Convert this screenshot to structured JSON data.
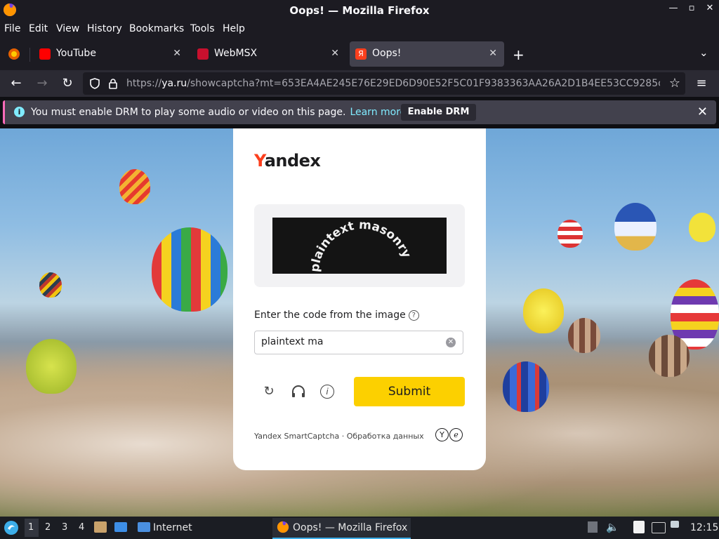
{
  "window": {
    "title": "Oops! — Mozilla Firefox"
  },
  "menu": [
    "File",
    "Edit",
    "View",
    "History",
    "Bookmarks",
    "Tools",
    "Help"
  ],
  "tabs": [
    {
      "label": "YouTube",
      "favicon_color": "#ff0000"
    },
    {
      "label": "WebMSX",
      "favicon_color": "#c8102e"
    },
    {
      "label": "Oops!",
      "favicon_color": "#fc3f1d",
      "active": true
    }
  ],
  "url": {
    "prefix": "https://",
    "host": "ya.ru",
    "rest": "/showcaptcha?mt=653EA4AE245E76E29ED6D90E52F5C01F9383363AA26A2D1B4EE53CC9285c"
  },
  "drm": {
    "message": "You must enable DRM to play some audio or video on this page.",
    "learn_more": "Learn more",
    "enable_button": "Enable DRM"
  },
  "captcha": {
    "logo_first": "Y",
    "logo_rest": "andex",
    "image_text": "plaintext masonry",
    "prompt": "Enter the code from the image",
    "input_value": "plaintext ma",
    "submit_label": "Submit",
    "footer": "Yandex SmartCaptcha · Обработка данных"
  },
  "taskbar": {
    "workspaces": [
      "1",
      "2",
      "3",
      "4"
    ],
    "launcher_label": "Internet",
    "window_title": "Oops! — Mozilla Firefox",
    "clock": "12:15"
  },
  "colors": {
    "accent_yandex": "#fc3f1d",
    "submit": "#fcd000",
    "drm_link": "#80ebff"
  }
}
